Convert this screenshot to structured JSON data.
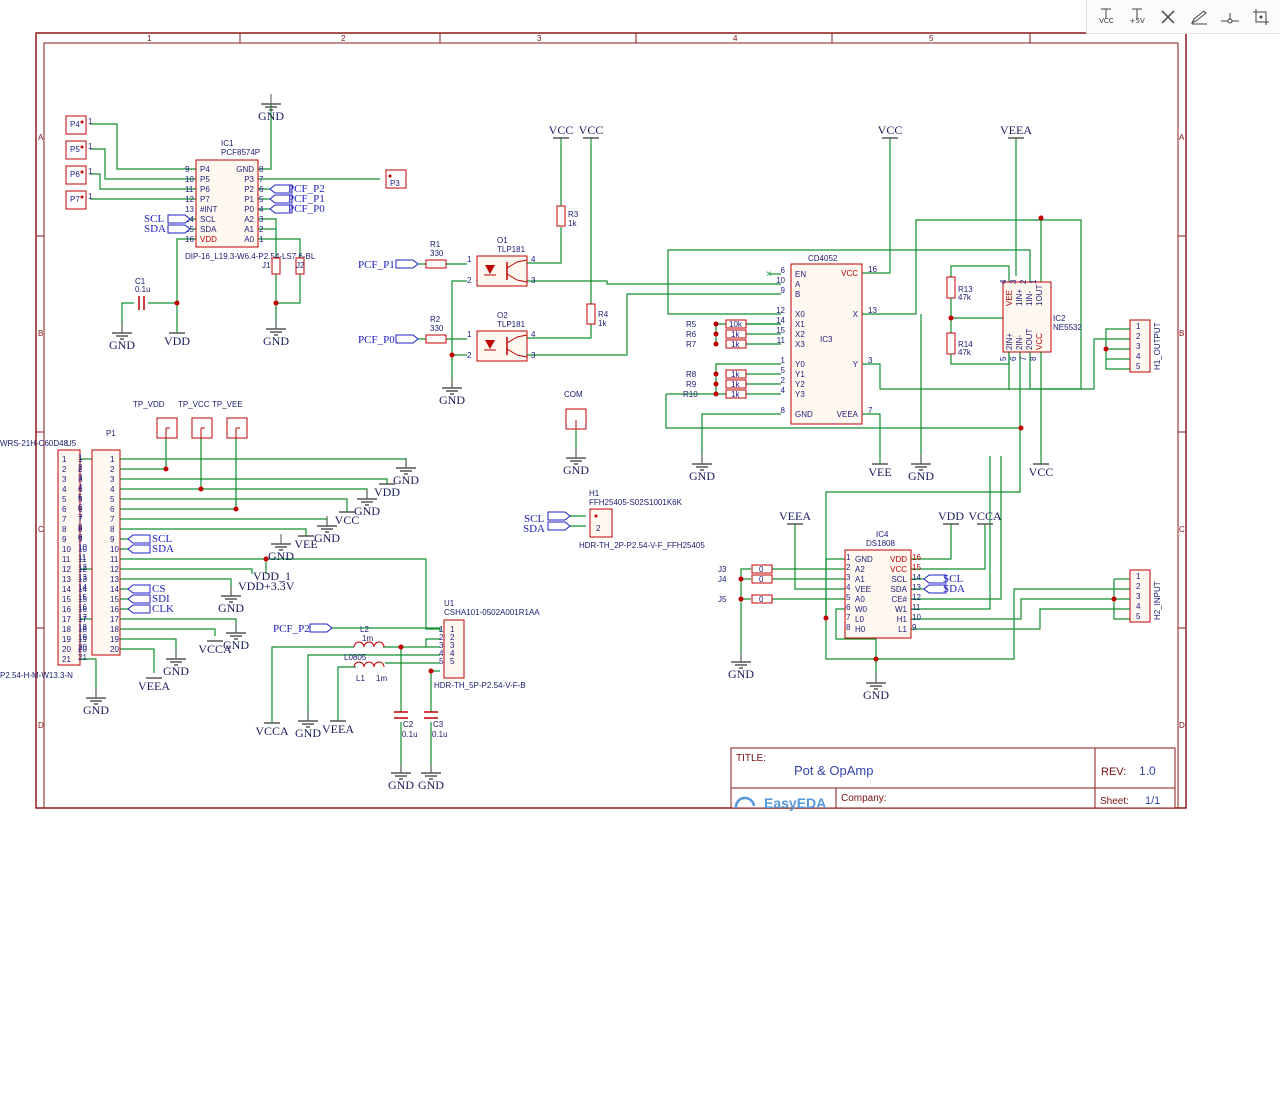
{
  "toolbar": {
    "vcc": "VCC",
    "p5v": "+5V"
  },
  "frame": {
    "columns": [
      "1",
      "2",
      "3",
      "4",
      "5"
    ],
    "rows": [
      "A",
      "B",
      "C",
      "D"
    ]
  },
  "title_block": {
    "title_label": "TITLE:",
    "title": "Pot & OpAmp",
    "rev_label": "REV:",
    "rev": "1.0",
    "company_label": "Company:",
    "sheet_label": "Sheet:",
    "sheet": "1/1",
    "logo": "EasyEDA"
  },
  "parts": {
    "ic1": {
      "ref": "IC1",
      "value": "PCF8574P",
      "footprint": "DIP-16_L19.3-W6.4-P2.54-LS7.6-BL",
      "left_pins": [
        "P4",
        "P5",
        "P6",
        "P7",
        "#INT",
        "SCL",
        "SDA",
        "VDD"
      ],
      "left_nums": [
        "9",
        "10",
        "11",
        "12",
        "13",
        "14",
        "15",
        "16"
      ],
      "right_pins": [
        "GND",
        "P3",
        "P2",
        "P1",
        "P0",
        "A2",
        "A1",
        "A0"
      ],
      "right_nums": [
        "8",
        "7",
        "6",
        "5",
        "4",
        "3",
        "2",
        "1"
      ]
    },
    "ic3": {
      "ref": "IC3",
      "value": "CD4052",
      "left_pins": [
        "EN",
        "A",
        "B",
        "X0",
        "X1",
        "X2",
        "X3",
        "Y0",
        "Y1",
        "Y2",
        "Y3",
        "GND"
      ],
      "left_nums": [
        "6",
        "10",
        "9",
        "12",
        "14",
        "15",
        "11",
        "1",
        "5",
        "2",
        "4",
        "8"
      ],
      "right_pins": [
        "VCC",
        "X",
        "Y",
        "VEEA"
      ],
      "right_nums": [
        "16",
        "13",
        "3",
        "7"
      ]
    },
    "ic2": {
      "ref": "IC2",
      "value": "NE5532",
      "top_pins": [
        "VEE",
        "1IN+",
        "1IN-",
        "1OUT"
      ],
      "top_nums": [
        "4",
        "3",
        "2",
        "1"
      ],
      "bottom_pins": [
        "2IN+",
        "2IN-",
        "2OUT",
        "VCC"
      ],
      "bottom_nums": [
        "5",
        "6",
        "7",
        "8"
      ]
    },
    "ic4": {
      "ref": "IC4",
      "value": "DS1808",
      "left_pins": [
        "GND",
        "A2",
        "A1",
        "VEE",
        "A0",
        "W0",
        "L0",
        "H0"
      ],
      "left_nums": [
        "1",
        "2",
        "3",
        "4",
        "5",
        "6",
        "7",
        "8"
      ],
      "right_pins": [
        "VDD",
        "VCC",
        "SCL",
        "SDA",
        "CE#",
        "W1",
        "H1",
        "L1"
      ],
      "right_nums": [
        "16",
        "15",
        "14",
        "13",
        "12",
        "11",
        "10",
        "9"
      ]
    },
    "o1": {
      "ref": "O1",
      "value": "TLP181"
    },
    "o2": {
      "ref": "O2",
      "value": "TLP181"
    },
    "u1": {
      "ref": "U1",
      "value": "CSHA101-0502A001R1AA",
      "footprint": "HDR-TH_5P-P2.54-V-F-B",
      "pins": [
        "1",
        "2",
        "3",
        "4",
        "5"
      ]
    },
    "u5": {
      "ref": "U5",
      "value": "WRS-21H-C60D48",
      "footprint": "P2.54-H-M-W13.3-N"
    },
    "p1": {
      "ref": "P1"
    },
    "h1": {
      "ref": "H1",
      "value": "FFH25405-S02S1001K6K",
      "footprint": "HDR-TH_2P-P2.54-V-F_FFH25405"
    },
    "h1_out": {
      "ref": "H1_OUTPUT",
      "pins": [
        "1",
        "2",
        "3",
        "4",
        "5"
      ]
    },
    "h2_in": {
      "ref": "H2_INPUT",
      "pins": [
        "1",
        "2",
        "3",
        "4",
        "5"
      ]
    },
    "r1": {
      "ref": "R1",
      "value": "330"
    },
    "r2": {
      "ref": "R2",
      "value": "330"
    },
    "r3": {
      "ref": "R3",
      "value": "1k"
    },
    "r4": {
      "ref": "R4",
      "value": "1k"
    },
    "r13": {
      "ref": "R13",
      "value": "47k"
    },
    "r14": {
      "ref": "R14",
      "value": "47k"
    },
    "r5": {
      "ref": "R5",
      "value": "10k"
    },
    "r6": {
      "ref": "R6",
      "value": "1k"
    },
    "r7": {
      "ref": "R7",
      "value": "1k"
    },
    "r8": {
      "ref": "R8",
      "value": "1k"
    },
    "r9": {
      "ref": "R9",
      "value": "1k"
    },
    "r10": {
      "ref": "R10",
      "value": "1k"
    },
    "c1": {
      "ref": "C1",
      "value": "0.1u"
    },
    "c2": {
      "ref": "C2",
      "value": "0.1u"
    },
    "c3": {
      "ref": "C3",
      "value": "0.1u"
    },
    "l1": {
      "ref": "L1",
      "value": "1m",
      "footprint": "L0805"
    },
    "l2": {
      "ref": "L2",
      "value": "1m"
    },
    "j1": {
      "ref": "J1"
    },
    "j2": {
      "ref": "J2"
    },
    "j3": {
      "ref": "J3",
      "value": "0"
    },
    "j4": {
      "ref": "J4",
      "value": "0"
    },
    "j5": {
      "ref": "J5",
      "value": "0"
    },
    "p3": {
      "ref": "P3"
    },
    "p4": {
      "ref": "P4"
    },
    "p5": {
      "ref": "P5"
    },
    "p6": {
      "ref": "P6"
    },
    "p7": {
      "ref": "P7"
    },
    "tp_vdd": {
      "ref": "TP_VDD"
    },
    "tp_vcc": {
      "ref": "TP_VCC"
    },
    "tp_vee": {
      "ref": "TP_VEE"
    },
    "com": {
      "ref": "COM"
    }
  },
  "nets": {
    "gnd": "GND",
    "vdd": "VDD",
    "vcc": "VCC",
    "vee": "VEE",
    "veea": "VEEA",
    "vcca": "VCCA",
    "vdd1": "VDD_1",
    "vdd33": "VDD+3.3V",
    "pcf_p0": "PCF_P0",
    "pcf_p1": "PCF_P1",
    "pcf_p2": "PCF_P2",
    "scl": "SCL",
    "sda": "SDA",
    "cs": "CS",
    "sdi": "SDI",
    "clk": "CLK"
  },
  "u5_pins": [
    "1",
    "2",
    "3",
    "4",
    "5",
    "6",
    "7",
    "8",
    "9",
    "10",
    "11",
    "12",
    "13",
    "14",
    "15",
    "16",
    "17",
    "18",
    "19",
    "20",
    "21"
  ],
  "p1_pins": [
    "1",
    "2",
    "3",
    "4",
    "5",
    "6",
    "7",
    "8",
    "9",
    "10",
    "11",
    "12",
    "13",
    "14",
    "15",
    "16",
    "17",
    "18",
    "19",
    "20"
  ]
}
